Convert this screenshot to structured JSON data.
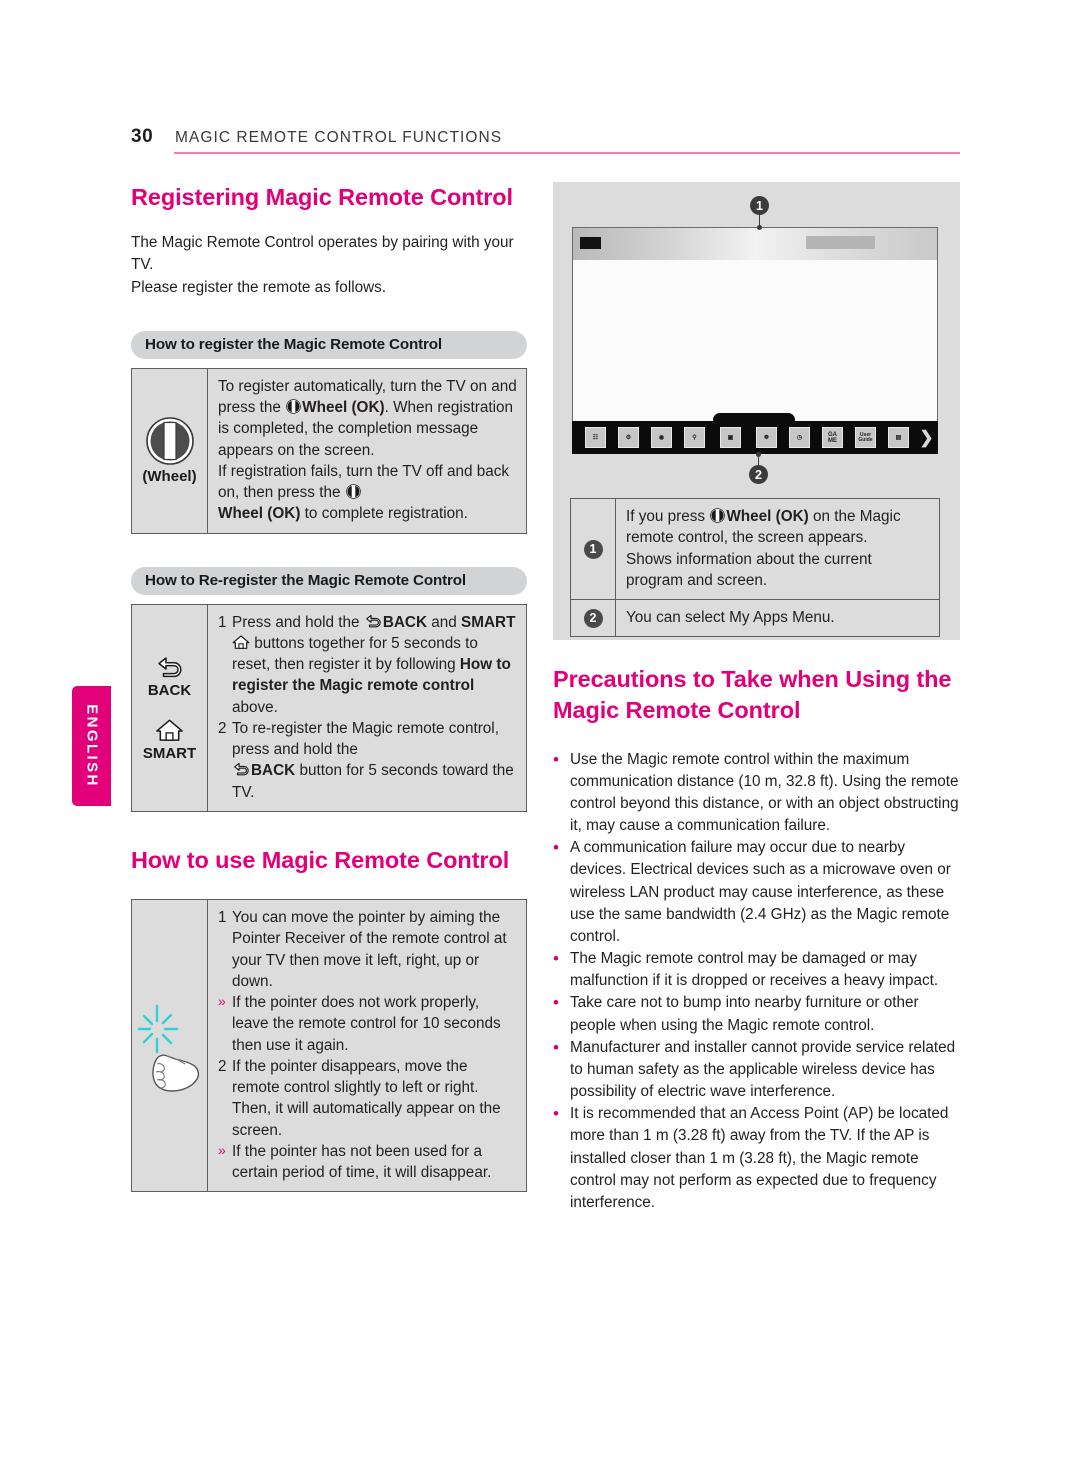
{
  "header": {
    "page_number": "30",
    "title": "MAGIC REMOTE CONTROL FUNCTIONS",
    "rule_color": "#ef7fb8"
  },
  "side_tab": {
    "label": "ENGLISH",
    "color": "#e2007a"
  },
  "colors": {
    "accent_magenta": "#e2007a",
    "table_fill": "#dcdcdc",
    "pill_fill": "#d2d3d5",
    "pointer_cyan": "#2fd0d8"
  },
  "left_column": {
    "heading_register": "Registering Magic Remote Control",
    "intro_line1": "The Magic Remote Control operates by pairing with your TV.",
    "intro_line2": "Please register the remote as follows.",
    "pill_register": "How to register the Magic Remote Control",
    "register_table": {
      "icon_label": "(Wheel)",
      "icon_name": "wheel-icon",
      "text_parts": [
        "To register automatically, turn the TV on and press the ",
        "Wheel (OK)",
        ". When registration is completed, the completion message appears on the screen.",
        "If registration fails, turn the TV off and back on, then press the ",
        "Wheel (OK)",
        " to complete registration."
      ]
    },
    "pill_reregister": "How to Re-register the Magic Remote Control",
    "reregister_table": {
      "icon_back_label": "BACK",
      "icon_smart_label": "SMART",
      "items": [
        {
          "number": "1",
          "parts": [
            "Press and hold the ",
            "BACK",
            " and ",
            "SMART",
            " buttons together for 5 seconds to reset, then register it by following ",
            "How to register the Magic remote control",
            " above."
          ]
        },
        {
          "number": "2",
          "parts": [
            "To re-register the Magic remote control, press and hold the ",
            "BACK",
            " button for 5 seconds toward the TV."
          ]
        }
      ]
    },
    "heading_use": "How to use Magic Remote Control",
    "use_table": {
      "icon_name": "pointer-hand-icon",
      "items": [
        {
          "marker": "1",
          "type": "number",
          "text": "You can move the pointer by aiming the Pointer Receiver of the remote control at your TV then move it left, right, up or down."
        },
        {
          "marker": "»",
          "type": "sub",
          "text": "If the pointer does not work properly, leave the remote control for 10 seconds then use it again."
        },
        {
          "marker": "2",
          "type": "number",
          "text": "If the pointer disappears, move the remote control slightly to left or right. Then, it will automatically appear on the screen."
        },
        {
          "marker": "»",
          "type": "sub",
          "text": "If the pointer has not been used for a certain period of time, it will disappear."
        }
      ]
    }
  },
  "right_column": {
    "tv_screenshot": {
      "callout_1": "❶",
      "callout_2": "❷",
      "callout_1_number": "1",
      "callout_2_number": "2",
      "dock_icons": [
        {
          "name": "channel-list-icon",
          "glyph": "☷"
        },
        {
          "name": "settings-gear-icon",
          "glyph": "⚙"
        },
        {
          "name": "internet-globe-icon",
          "glyph": "●"
        },
        {
          "name": "search-icon",
          "glyph": "⚲"
        },
        {
          "name": "tv-icon",
          "glyph": "▣"
        },
        {
          "name": "social-icon",
          "glyph": "☸"
        },
        {
          "name": "clock-icon",
          "glyph": "◷"
        },
        {
          "name": "game-icon",
          "glyph": "GAME"
        },
        {
          "name": "user-guide-icon",
          "glyph": "User Guide"
        },
        {
          "name": "input-icon",
          "glyph": "▤"
        },
        {
          "name": "more-arrow-icon",
          "glyph": "❯"
        }
      ]
    },
    "screen_table": {
      "rows": [
        {
          "number": "1",
          "parts": [
            "If you press ",
            "Wheel (OK)",
            " on the Magic remote control, the screen appears.",
            "Shows information about the current program and screen."
          ]
        },
        {
          "number": "2",
          "text": "You can select My Apps Menu."
        }
      ]
    },
    "heading_precautions": "Precautions to Take when Using the Magic Remote Control",
    "precautions": [
      "Use the Magic remote control within the maximum communication distance (10 m, 32.8 ft). Using the remote control beyond this distance, or with an object obstructing it, may cause a communication failure.",
      "A communication failure may occur due to nearby devices. Electrical devices such as a microwave oven or wireless LAN product may cause interference, as these use the same bandwidth (2.4 GHz) as the Magic remote control.",
      "The Magic remote control may be damaged or may malfunction if it is dropped or receives a heavy impact.",
      "Take care not to bump into nearby furniture or other people when using the Magic remote control.",
      "Manufacturer and installer cannot provide service related to human safety as the applicable wireless device has possibility of electric wave interference.",
      "It is recommended that an Access Point (AP) be located more than 1 m (3.28 ft) away from the TV. If the AP is installed closer than 1 m (3.28 ft), the Magic remote control may not perform as expected due to frequency interference."
    ]
  }
}
